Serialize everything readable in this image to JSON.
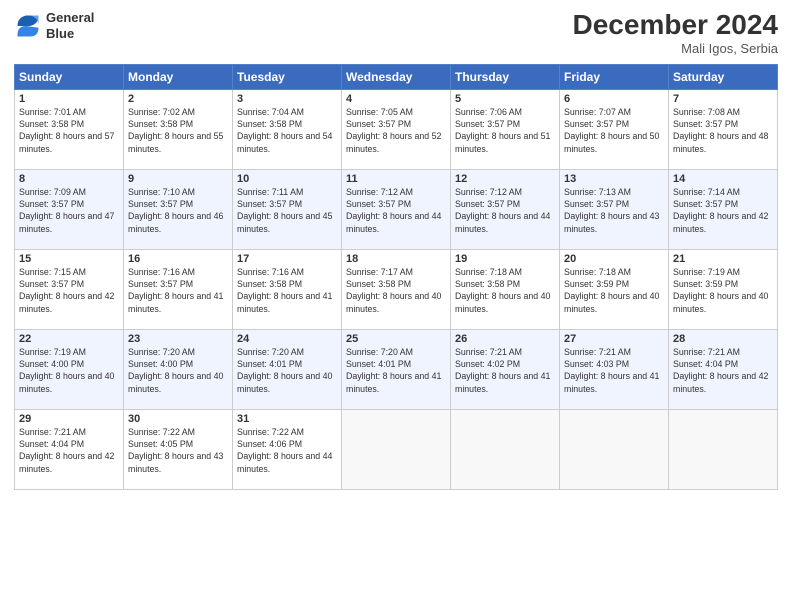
{
  "logo": {
    "line1": "General",
    "line2": "Blue"
  },
  "title": "December 2024",
  "subtitle": "Mali Igos, Serbia",
  "headers": [
    "Sunday",
    "Monday",
    "Tuesday",
    "Wednesday",
    "Thursday",
    "Friday",
    "Saturday"
  ],
  "weeks": [
    [
      {
        "day": "1",
        "rise": "7:01 AM",
        "set": "3:58 PM",
        "daylight": "8 hours and 57 minutes."
      },
      {
        "day": "2",
        "rise": "7:02 AM",
        "set": "3:58 PM",
        "daylight": "8 hours and 55 minutes."
      },
      {
        "day": "3",
        "rise": "7:04 AM",
        "set": "3:58 PM",
        "daylight": "8 hours and 54 minutes."
      },
      {
        "day": "4",
        "rise": "7:05 AM",
        "set": "3:57 PM",
        "daylight": "8 hours and 52 minutes."
      },
      {
        "day": "5",
        "rise": "7:06 AM",
        "set": "3:57 PM",
        "daylight": "8 hours and 51 minutes."
      },
      {
        "day": "6",
        "rise": "7:07 AM",
        "set": "3:57 PM",
        "daylight": "8 hours and 50 minutes."
      },
      {
        "day": "7",
        "rise": "7:08 AM",
        "set": "3:57 PM",
        "daylight": "8 hours and 48 minutes."
      }
    ],
    [
      {
        "day": "8",
        "rise": "7:09 AM",
        "set": "3:57 PM",
        "daylight": "8 hours and 47 minutes."
      },
      {
        "day": "9",
        "rise": "7:10 AM",
        "set": "3:57 PM",
        "daylight": "8 hours and 46 minutes."
      },
      {
        "day": "10",
        "rise": "7:11 AM",
        "set": "3:57 PM",
        "daylight": "8 hours and 45 minutes."
      },
      {
        "day": "11",
        "rise": "7:12 AM",
        "set": "3:57 PM",
        "daylight": "8 hours and 44 minutes."
      },
      {
        "day": "12",
        "rise": "7:12 AM",
        "set": "3:57 PM",
        "daylight": "8 hours and 44 minutes."
      },
      {
        "day": "13",
        "rise": "7:13 AM",
        "set": "3:57 PM",
        "daylight": "8 hours and 43 minutes."
      },
      {
        "day": "14",
        "rise": "7:14 AM",
        "set": "3:57 PM",
        "daylight": "8 hours and 42 minutes."
      }
    ],
    [
      {
        "day": "15",
        "rise": "7:15 AM",
        "set": "3:57 PM",
        "daylight": "8 hours and 42 minutes."
      },
      {
        "day": "16",
        "rise": "7:16 AM",
        "set": "3:57 PM",
        "daylight": "8 hours and 41 minutes."
      },
      {
        "day": "17",
        "rise": "7:16 AM",
        "set": "3:58 PM",
        "daylight": "8 hours and 41 minutes."
      },
      {
        "day": "18",
        "rise": "7:17 AM",
        "set": "3:58 PM",
        "daylight": "8 hours and 40 minutes."
      },
      {
        "day": "19",
        "rise": "7:18 AM",
        "set": "3:58 PM",
        "daylight": "8 hours and 40 minutes."
      },
      {
        "day": "20",
        "rise": "7:18 AM",
        "set": "3:59 PM",
        "daylight": "8 hours and 40 minutes."
      },
      {
        "day": "21",
        "rise": "7:19 AM",
        "set": "3:59 PM",
        "daylight": "8 hours and 40 minutes."
      }
    ],
    [
      {
        "day": "22",
        "rise": "7:19 AM",
        "set": "4:00 PM",
        "daylight": "8 hours and 40 minutes."
      },
      {
        "day": "23",
        "rise": "7:20 AM",
        "set": "4:00 PM",
        "daylight": "8 hours and 40 minutes."
      },
      {
        "day": "24",
        "rise": "7:20 AM",
        "set": "4:01 PM",
        "daylight": "8 hours and 40 minutes."
      },
      {
        "day": "25",
        "rise": "7:20 AM",
        "set": "4:01 PM",
        "daylight": "8 hours and 41 minutes."
      },
      {
        "day": "26",
        "rise": "7:21 AM",
        "set": "4:02 PM",
        "daylight": "8 hours and 41 minutes."
      },
      {
        "day": "27",
        "rise": "7:21 AM",
        "set": "4:03 PM",
        "daylight": "8 hours and 41 minutes."
      },
      {
        "day": "28",
        "rise": "7:21 AM",
        "set": "4:04 PM",
        "daylight": "8 hours and 42 minutes."
      }
    ],
    [
      {
        "day": "29",
        "rise": "7:21 AM",
        "set": "4:04 PM",
        "daylight": "8 hours and 42 minutes."
      },
      {
        "day": "30",
        "rise": "7:22 AM",
        "set": "4:05 PM",
        "daylight": "8 hours and 43 minutes."
      },
      {
        "day": "31",
        "rise": "7:22 AM",
        "set": "4:06 PM",
        "daylight": "8 hours and 44 minutes."
      },
      null,
      null,
      null,
      null
    ]
  ]
}
